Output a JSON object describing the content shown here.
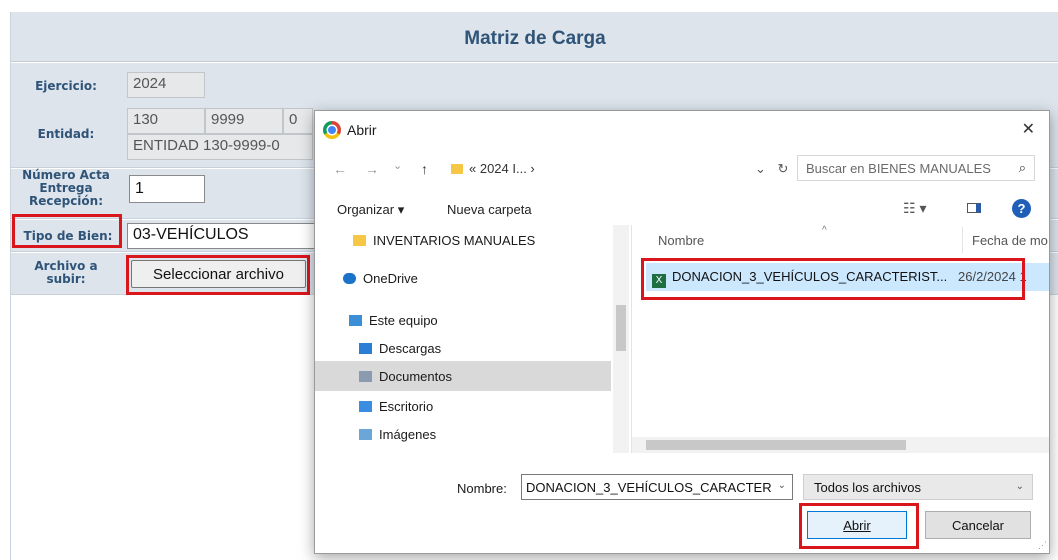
{
  "form": {
    "title": "Matriz de Carga",
    "labels": {
      "ejercicio": "Ejercicio:",
      "entidad": "Entidad:",
      "numero_acta_1": "Número Acta",
      "numero_acta_2": "Entrega",
      "numero_acta_3": "Recepción:",
      "tipo_bien": "Tipo de Bien:",
      "archivo_1": "Archivo a",
      "archivo_2": "subir:"
    },
    "ejercicio_value": "2024",
    "entidad_code1": "130",
    "entidad_code2": "9999",
    "entidad_code3": "0",
    "entidad_name": "ENTIDAD 130-9999-0",
    "numero_acta_value": "1",
    "tipo_bien_value": "03-VEHÍCULOS",
    "file_button_label": "Seleccionar archivo"
  },
  "dialog": {
    "title": "Abrir",
    "close_glyph": "✕",
    "nav_back": "←",
    "nav_forward": "→",
    "nav_dropdown": "⌄",
    "nav_up": "↑",
    "breadcrumb": "« 2024 I...  ›",
    "addr_dropdown": "⌄",
    "refresh": "↻",
    "search_placeholder": "Buscar en BIENES MANUALES",
    "search_glyph": "⌕",
    "organize_label": "Organizar ▾",
    "new_folder_label": "Nueva carpeta",
    "view_glyph": "☷ ▾",
    "help_glyph": "?",
    "nav_items": [
      {
        "label": "INVENTARIOS MANUALES",
        "icon": "folder-icon",
        "color": "#f6c744"
      },
      {
        "label": "OneDrive",
        "icon": "cloud-icon",
        "color": "#1a73c8"
      },
      {
        "label": "Este equipo",
        "icon": "computer-icon",
        "color": "#3b8fd6"
      },
      {
        "label": "Descargas",
        "icon": "downloads-icon",
        "color": "#2a7fd4"
      },
      {
        "label": "Documentos",
        "icon": "documents-icon",
        "color": "#8a9bb0"
      },
      {
        "label": "Escritorio",
        "icon": "desktop-icon",
        "color": "#3a8de0"
      },
      {
        "label": "Imágenes",
        "icon": "images-icon",
        "color": "#6aa7d8"
      }
    ],
    "col_name": "Nombre",
    "col_date": "Fecha de mo",
    "file_name": "DONACION_3_VEHÍCULOS_CARACTERIST...",
    "file_date": "26/2/2024 1",
    "name_label": "Nombre:",
    "name_value": "DONACION_3_VEHÍCULOS_CARACTER",
    "dropdown_glyph": "⌄",
    "type_value": "Todos los archivos",
    "open_label": "Abrir",
    "cancel_label": "Cancelar"
  },
  "colors": {
    "highlight": "#d9161c",
    "label_blue": "#2f5478",
    "form_bg": "#dde4ec",
    "selection": "#cce8ff"
  }
}
